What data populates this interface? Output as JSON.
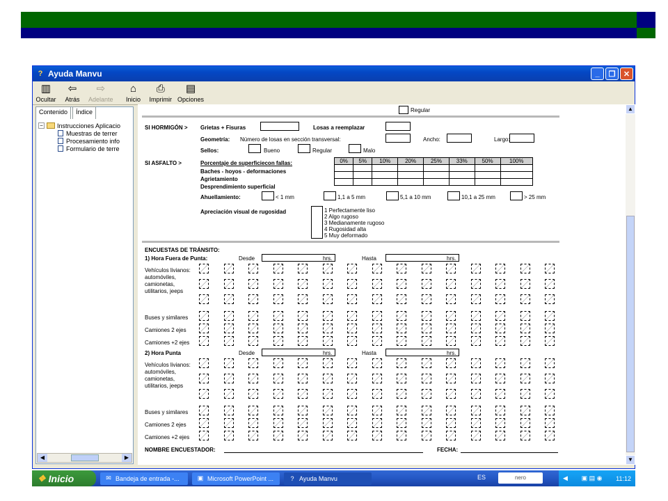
{
  "window": {
    "title": "Ayuda Manvu"
  },
  "toolbar": {
    "hide": "Ocultar",
    "back": "Atrás",
    "forward": "Adelante",
    "home": "Inicio",
    "print": "Imprimir",
    "options": "Opciones"
  },
  "tabs": {
    "contents": "Contenido",
    "index": "Índice"
  },
  "tree": {
    "root": "Instrucciones Aplicacio",
    "items": [
      "Muestras de terrer",
      "Procesamiento info",
      "Formulario de terre"
    ]
  },
  "form": {
    "regular_top": "Regular",
    "hormigon_label": "SI HORMIGÓN >",
    "grietas": "Grietas + Fisuras",
    "losas_reemplazar": "Losas a reemplazar",
    "geometria": "Geometría:",
    "num_losas": "Número de losas en sección transversal:",
    "ancho": "Ancho:",
    "largo": "Largo:",
    "sellos": "Sellos:",
    "bueno": "Bueno",
    "regular": "Regular",
    "malo": "Malo",
    "asfalto_label": "SI ASFALTO >",
    "porcentaje": "Porcentaje de superficiecon fallas:",
    "percent_cols": [
      "0%",
      "5%",
      "10%",
      "20%",
      "25%",
      "33%",
      "50%",
      "100%"
    ],
    "fallas": [
      "Baches - hoyos - deformaciones",
      "Agrietamiento",
      "Desprendimiento superficial"
    ],
    "ahuellamiento": "Ahuellamiento:",
    "ahuell_opts": [
      "< 1 mm",
      "1,1 a 5 mm",
      "5,1 a 10 mm",
      "10,1 a 25 mm",
      "> 25 mm"
    ],
    "apreciacion": "Apreciación visual de rugosidad",
    "rugosidad": [
      "1 Perfectamente liso",
      "2 Algo rugoso",
      "3 Medianamente rugoso",
      "4 Rugosidad alta",
      "5 Muy deformado"
    ],
    "encuestas": "ENCUESTAS DE TRÁNSITO:",
    "hora1": "1) Hora Fuera de Punta:",
    "hora2": "2) Hora Punta",
    "desde": "Desde",
    "hasta": "Hasta",
    "hrs": "hrs.",
    "vehiculos": "Vehículos livianos: automóviles, camionetas, utilitarios, jeeps",
    "buses": "Buses y similares",
    "camiones2": "Camiones 2 ejes",
    "camiones3": "Camiones +2 ejes",
    "nombre": "NOMBRE ENCUESTADOR:",
    "fecha": "FECHA:"
  },
  "taskbar": {
    "start": "Inicio",
    "tasks": [
      "Bandeja de entrada -...",
      "Microsoft PowerPoint ...",
      "Ayuda Manvu"
    ],
    "lang": "ES",
    "nero": "nero",
    "time": "11:12"
  }
}
